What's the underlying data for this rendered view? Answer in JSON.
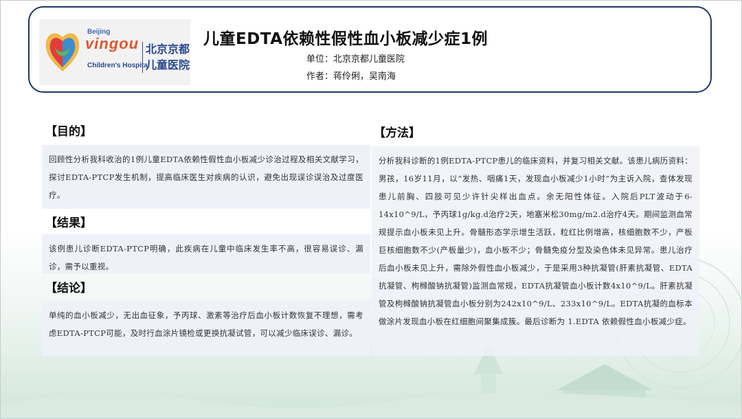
{
  "header": {
    "title": "儿童EDTA依赖性假性血小板减少症1例",
    "unit_label": "单位：",
    "unit": "北京京都儿童医院",
    "author_label": "作者：",
    "authors": "蒋伶俐，吴南海"
  },
  "logo": {
    "line1": "Beijing",
    "line2": "vingou",
    "line3": "Children's Hospital",
    "cn": "北京京都儿童医院"
  },
  "sections": {
    "purpose": {
      "title": "【目的】",
      "text": "回顾性分析我科收治的1例儿童EDTA依赖性假性血小板减少诊治过程及相关文献学习，探讨EDTA-PTCP发生机制，提高临床医生对疾病的认识，避免出现误诊误治及过度医疗。"
    },
    "results": {
      "title": "【结果】",
      "text": "该例患儿诊断EDTA-PTCP明确，此疾病在儿童中临床发生率不高，很容易误诊、漏诊，需予以重视。"
    },
    "conclusion": {
      "title": "【结论】",
      "text": "单纯的血小板减少，无出血征象，予丙球、激素等治疗后血小板计数恢复不理想，需考虑EDTA-PTCP可能，及时行血涂片镜检或更换抗凝试管，可以减少临床误诊、漏诊。"
    },
    "methods": {
      "title": "【方法】",
      "text": "分析我科诊断的1例EDTA-PTCP患儿的临床资料，并复习相关文献。该患儿病历资料：男孩，16岁11月，以“发热、咽痛1天，发现血小板减少1小时”为主诉入院，查体发现患儿前胸、四肢可见少许针尖样出血点。余无阳性体征。入院后PLT波动于6-14x10^9/L，予丙球1g/kg.d治疗2天，地塞米松30mg/m2.d治疗4天。期间监测血常规提示血小板未见上升。骨髓形态学示增生活跃，粒红比例增高，核细胞数不少，产板巨核细胞数不少(产板量少)，血小板不少；骨髓免疫分型及染色体未见异常。患儿治疗后血小板未见上升，需除外假性血小板减少，于是采用3种抗凝管(肝素抗凝管、EDTA抗凝管、枸橼酸钠抗凝管)监测血常规，EDTA抗凝管血小板计数4x10^9/L。肝素抗凝管及枸橼酸钠抗凝管血小板分别为242x10^9/L、233x10^9/L。EDTA抗凝的血标本做涂片发现血小板在红细胞间聚集成簇。最后诊断为 1.EDTA 依赖假性血小板减少症。"
    }
  }
}
